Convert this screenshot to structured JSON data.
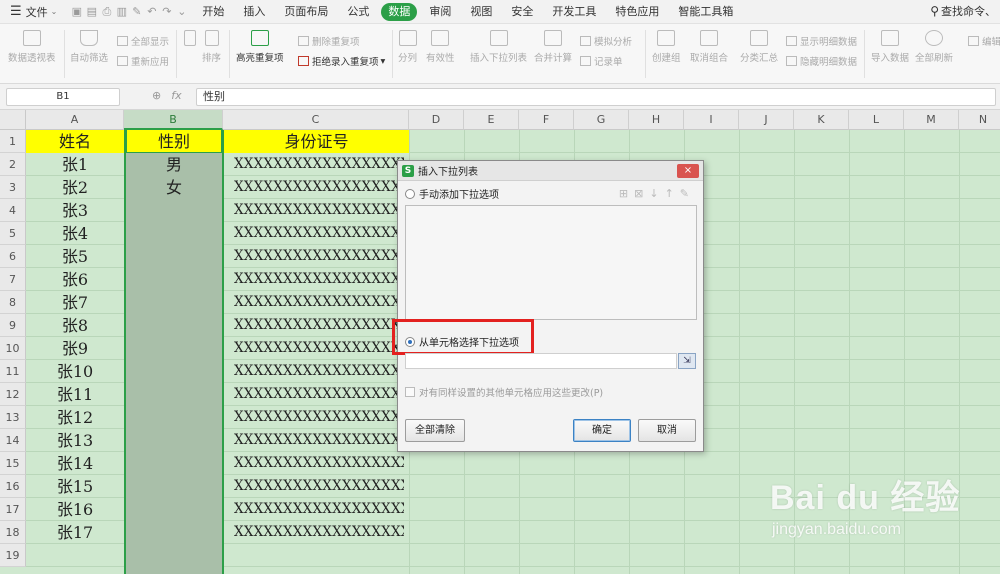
{
  "menubar": {
    "file_label": "文件",
    "tabs": [
      "开始",
      "插入",
      "页面布局",
      "公式",
      "数据",
      "审阅",
      "视图",
      "安全",
      "开发工具",
      "特色应用",
      "智能工具箱"
    ],
    "active_tab": "数据",
    "search_label": "查找命令、"
  },
  "ribbon": {
    "pivot": "数据透视表",
    "autofilter": "自动筛选",
    "show_all": "全部显示",
    "reapply": "重新应用",
    "sort": "排序",
    "highlight_dup": "高亮重复项",
    "delete_dup": "删除重复项",
    "reject_dup": "拒绝录入重复项",
    "split": "分列",
    "validity": "有效性",
    "insert_dropdown": "插入下拉列表",
    "merge_calc": "合并计算",
    "simulate": "模拟分析",
    "record": "记录单",
    "create_group": "创建组",
    "ungroup": "取消组合",
    "subtotal": "分类汇总",
    "show_detail": "显示明细数据",
    "hide_detail": "隐藏明细数据",
    "import_data": "导入数据",
    "refresh_all": "全部刷新",
    "edit_links": "编辑"
  },
  "formula_bar": {
    "name_box": "B1",
    "fx": "fx",
    "content": "性别"
  },
  "sheet": {
    "columns": [
      "A",
      "B",
      "C",
      "D",
      "E",
      "F",
      "G",
      "H",
      "I",
      "J",
      "K",
      "L",
      "M",
      "N"
    ],
    "selected_column": "B",
    "rows": [
      "1",
      "2",
      "3",
      "4",
      "5",
      "6",
      "7",
      "8",
      "9",
      "10",
      "11",
      "12",
      "13",
      "14",
      "15",
      "16",
      "17",
      "18",
      "19"
    ],
    "headers": {
      "a": "姓名",
      "b": "性别",
      "c": "身份证号"
    },
    "names": [
      "张1",
      "张2",
      "张3",
      "张4",
      "张5",
      "张6",
      "张7",
      "张8",
      "张9",
      "张10",
      "张11",
      "张12",
      "张13",
      "张14",
      "张15",
      "张16",
      "张17"
    ],
    "genders": [
      "男",
      "女"
    ],
    "id_value": "XXXXXXXXXXXXXXXXXX"
  },
  "dialog": {
    "title": "插入下拉列表",
    "close": "×",
    "option_manual": "手动添加下拉选项",
    "option_from_cells": "从单元格选择下拉选项",
    "range_value": "",
    "apply_all": "对有同样设置的其他单元格应用这些更改(P)",
    "clear_all": "全部清除",
    "ok": "确定",
    "cancel": "取消"
  },
  "watermark": {
    "logo": "Bai du 经验",
    "url": "jingyan.baidu.com"
  }
}
